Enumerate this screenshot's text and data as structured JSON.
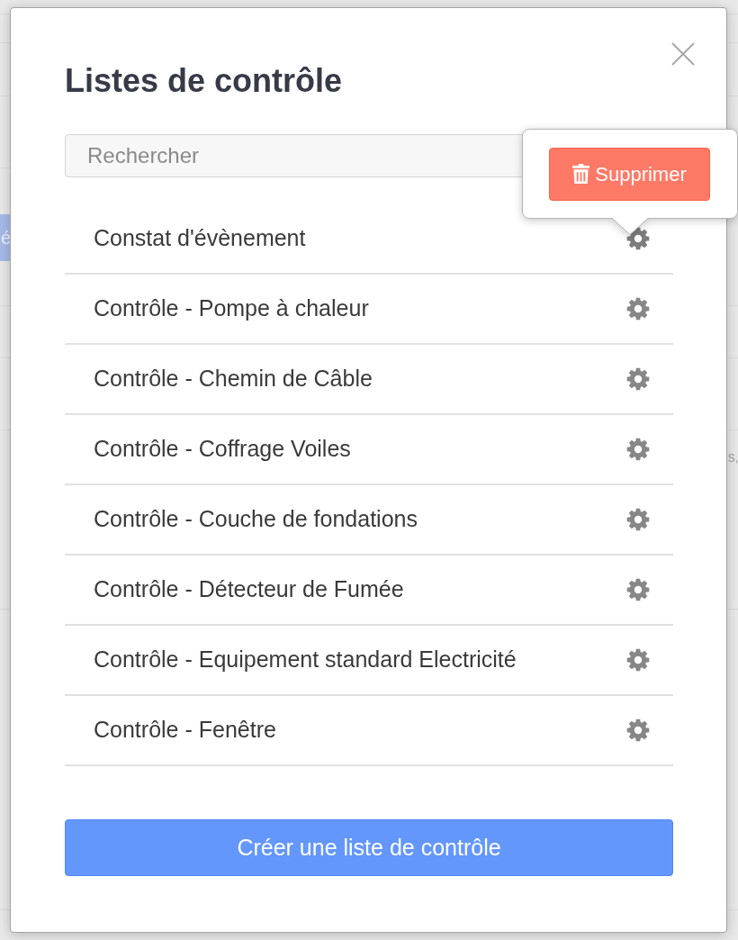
{
  "backdrop": {
    "tag_text": "é",
    "edge_text": "S,"
  },
  "dialog": {
    "title": "Listes de contrôle",
    "search": {
      "placeholder": "Rechercher"
    },
    "items": [
      {
        "label": "Constat d'évènement",
        "menu_open": true
      },
      {
        "label": "Contrôle - Pompe à chaleur",
        "menu_open": false
      },
      {
        "label": "Contrôle - Chemin de Câble",
        "menu_open": false
      },
      {
        "label": "Contrôle - Coffrage Voiles",
        "menu_open": false
      },
      {
        "label": "Contrôle - Couche de fondations",
        "menu_open": false
      },
      {
        "label": "Contrôle - Détecteur de Fumée",
        "menu_open": false
      },
      {
        "label": "Contrôle - Equipement standard Electricité",
        "menu_open": false
      },
      {
        "label": "Contrôle - Fenêtre",
        "menu_open": false
      }
    ],
    "item_menu": {
      "delete_label": "Supprimer"
    },
    "create_button": "Créer une liste de contrôle"
  }
}
